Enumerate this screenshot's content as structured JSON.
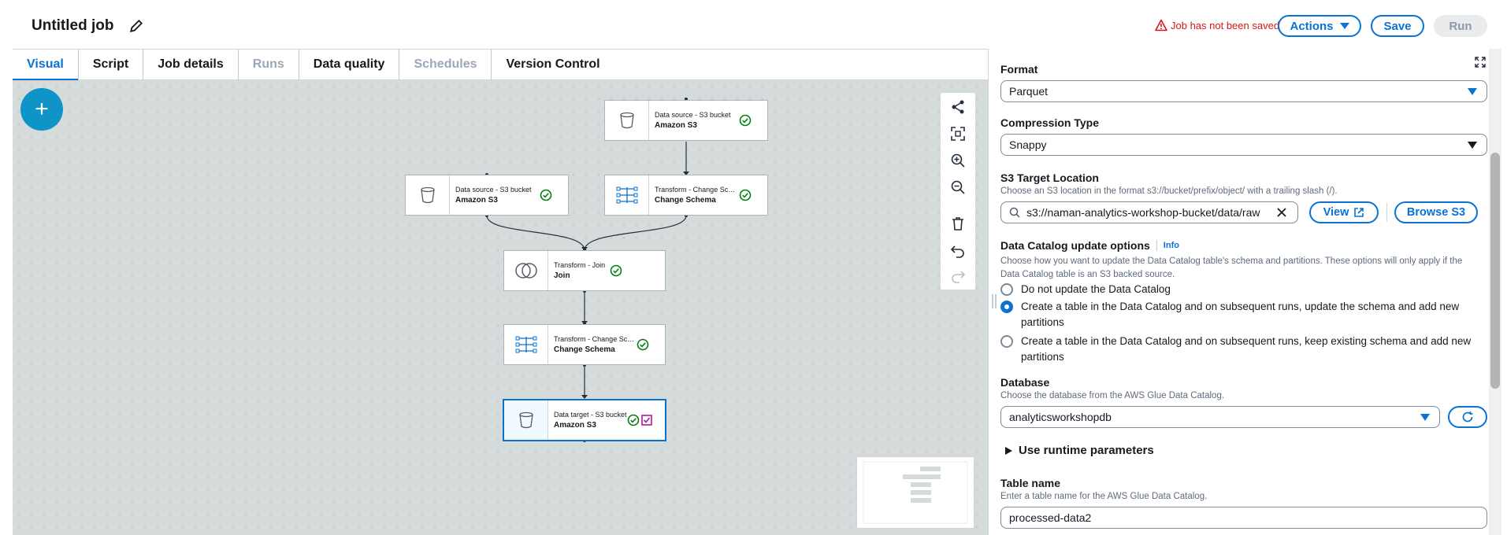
{
  "header": {
    "job_title": "Untitled job",
    "warning": "Job has not been saved",
    "actions_label": "Actions",
    "save_label": "Save",
    "run_label": "Run"
  },
  "tabs": [
    {
      "label": "Visual",
      "state": "active"
    },
    {
      "label": "Script",
      "state": "normal"
    },
    {
      "label": "Job details",
      "state": "normal"
    },
    {
      "label": "Runs",
      "state": "disabled"
    },
    {
      "label": "Data quality",
      "state": "normal"
    },
    {
      "label": "Schedules",
      "state": "disabled"
    },
    {
      "label": "Version Control",
      "state": "normal"
    }
  ],
  "canvas": {
    "add_label": "+",
    "nodes": [
      {
        "kind": "Data source - S3 bucket",
        "name": "Amazon S3",
        "icon": "bucket-icon"
      },
      {
        "kind": "Data source - S3 bucket",
        "name": "Amazon S3",
        "icon": "bucket-icon"
      },
      {
        "kind": "Transform - Change Sche...",
        "name": "Change Schema",
        "icon": "schema-icon"
      },
      {
        "kind": "Transform - Join",
        "name": "Join",
        "icon": "join-icon"
      },
      {
        "kind": "Transform - Change Sche...",
        "name": "Change Schema",
        "icon": "schema-icon"
      },
      {
        "kind": "Data target - S3 bucket",
        "name": "Amazon S3",
        "icon": "bucket-icon"
      }
    ],
    "tools": [
      "share-icon",
      "fit-icon",
      "zoom-in-icon",
      "zoom-out-icon",
      "delete-icon",
      "undo-icon",
      "redo-icon"
    ]
  },
  "panel": {
    "format": {
      "label": "Format",
      "value": "Parquet"
    },
    "compression": {
      "label": "Compression Type",
      "value": "Snappy"
    },
    "s3_target": {
      "label": "S3 Target Location",
      "description": "Choose an S3 location in the format s3://bucket/prefix/object/ with a trailing slash (/).",
      "value": "s3://naman-analytics-workshop-bucket/data/raw",
      "view_label": "View",
      "browse_label": "Browse S3"
    },
    "catalog": {
      "label": "Data Catalog update options",
      "info": "Info",
      "description": "Choose how you want to update the Data Catalog table's schema and partitions. These options will only apply if the Data Catalog table is an S3 backed source.",
      "options": [
        "Do not update the Data Catalog",
        "Create a table in the Data Catalog and on subsequent runs, update the schema and add new partitions",
        "Create a table in the Data Catalog and on subsequent runs, keep existing schema and add new partitions"
      ],
      "selected": 1
    },
    "database": {
      "label": "Database",
      "description": "Choose the database from the AWS Glue Data Catalog.",
      "value": "analyticsworkshopdb"
    },
    "runtime": {
      "label": "Use runtime parameters"
    },
    "table": {
      "label": "Table name",
      "description": "Enter a table name for the AWS Glue Data Catalog.",
      "value": "processed-data2"
    }
  }
}
